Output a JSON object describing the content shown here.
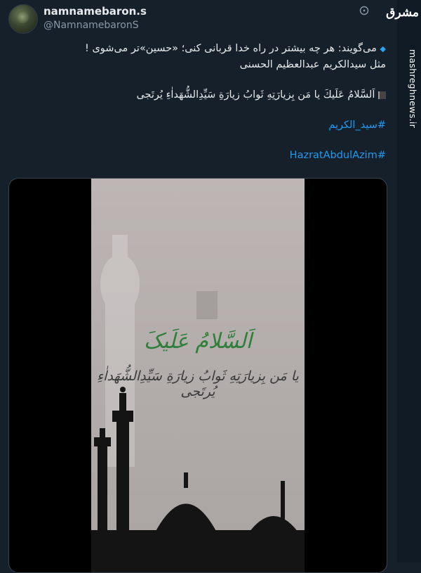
{
  "tweet": {
    "display_name": "namnamebaron.s",
    "handle": "@NamnamebaronS",
    "line1": "می‌گویند: هر چه بیشتر در راه خدا قربانی کنی؛ «حسین»تر می‌شوی !",
    "line2": "مثل سیدالکریم عبدالعظیم الحسنی",
    "line3": "اَلسَّلامُ عَلَیكَ یا مَن بِزیارَتِهِ ثَوابُ زیارَةِ سَیِّدِالشُّهَداٰءِ یُرتَجی",
    "hashtag1": "#سید_الکریم",
    "hashtag2": "#HazratAbdulAzim"
  },
  "media": {
    "title": "اَلسَّلامُ عَلَیکَ",
    "subtitle": "یا مَن بِزیارَتِهِ ثَوابُ زیارَةِ سَیِّدِالشُّهَداٰءِ یُرتَجی"
  },
  "watermark": {
    "logo": "مشرق",
    "site": "mashreghnews.ir"
  },
  "icons": {
    "more": "more-icon",
    "diamond": "small-blue-diamond-icon",
    "flag": "black-flag-icon"
  },
  "colors": {
    "background": "#15202b",
    "hashtag": "#1d9bf0",
    "title_green": "#2f7f3a"
  }
}
